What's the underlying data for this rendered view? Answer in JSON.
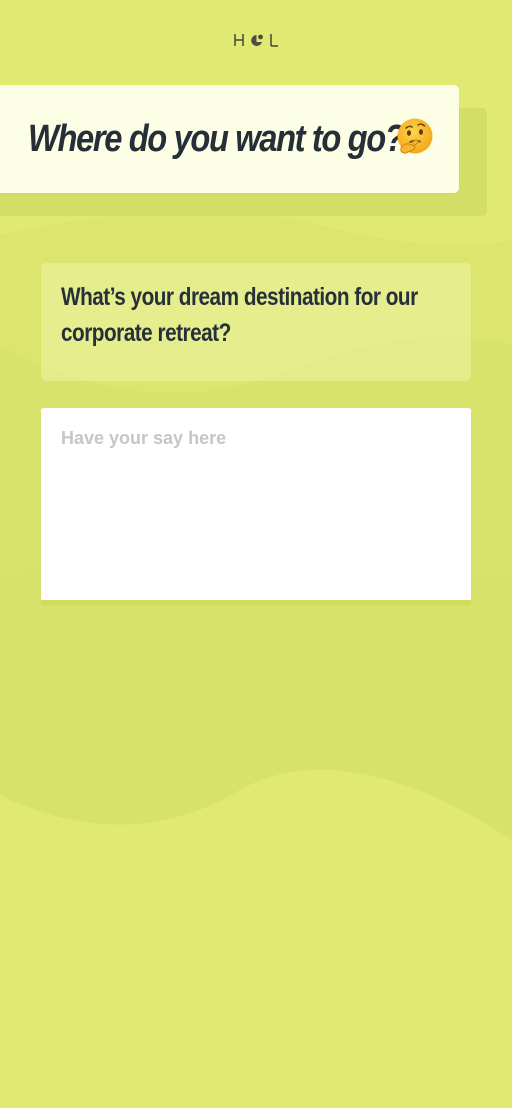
{
  "brand": {
    "logo_icon": "hol-logo-icon",
    "logo_color": "#4a4f45"
  },
  "header": {
    "title": "Where do you want to go?",
    "emoji_icon": "thinking-face-icon"
  },
  "question": {
    "text": "What’s your dream destination for our corporate retreat?"
  },
  "answer": {
    "placeholder": "Have your say here",
    "value": ""
  },
  "colors": {
    "background": "#e0ea72",
    "title_card": "#fcffe5",
    "text": "#262f38",
    "placeholder": "#c4c7c7"
  }
}
